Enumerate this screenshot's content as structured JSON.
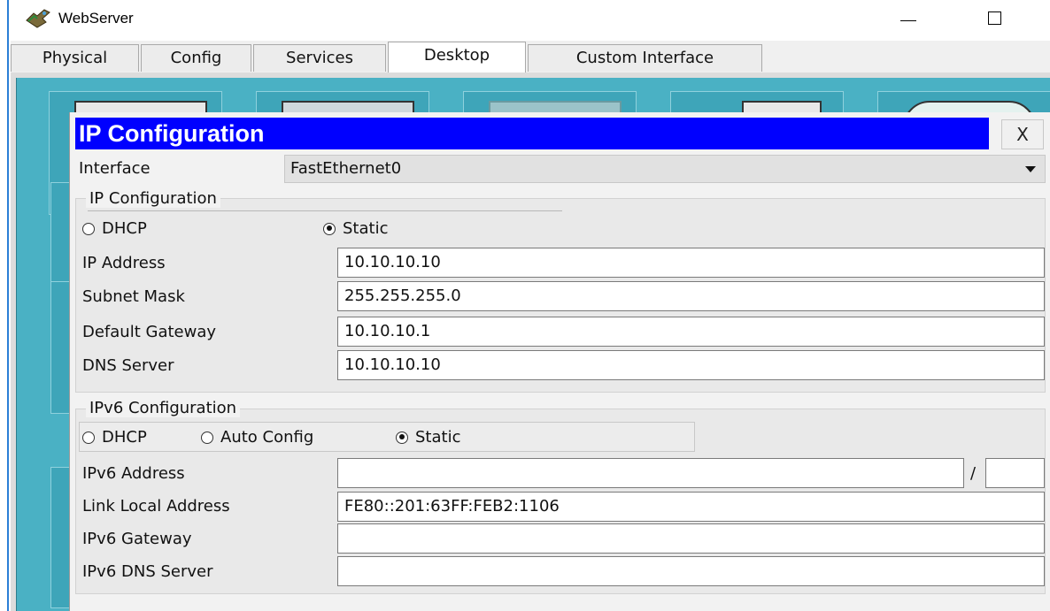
{
  "window": {
    "title": "WebServer",
    "icon": "packet-tracer-server-icon",
    "controls": {
      "minimize": "minimize-icon",
      "maximize": "maximize-icon"
    }
  },
  "tabs": [
    {
      "label": "Physical",
      "active": false
    },
    {
      "label": "Config",
      "active": false
    },
    {
      "label": "Services",
      "active": false
    },
    {
      "label": "Desktop",
      "active": true
    },
    {
      "label": "Custom Interface",
      "active": false
    }
  ],
  "dialog": {
    "title": "IP Configuration",
    "close_label": "X",
    "interface": {
      "label": "Interface",
      "value": "FastEthernet0"
    },
    "ipv4": {
      "legend": "IP Configuration",
      "dhcp_label": "DHCP",
      "static_label": "Static",
      "mode": "Static",
      "fields": {
        "ip_address": {
          "label": "IP Address",
          "value": "10.10.10.10"
        },
        "subnet_mask": {
          "label": "Subnet Mask",
          "value": "255.255.255.0"
        },
        "default_gateway": {
          "label": "Default Gateway",
          "value": "10.10.10.1"
        },
        "dns_server": {
          "label": "DNS Server",
          "value": "10.10.10.10"
        }
      }
    },
    "ipv6": {
      "legend": "IPv6 Configuration",
      "dhcp_label": "DHCP",
      "auto_label": "Auto Config",
      "static_label": "Static",
      "mode": "Static",
      "prefix_separator": "/",
      "fields": {
        "ipv6_address": {
          "label": "IPv6 Address",
          "value": "",
          "prefix": ""
        },
        "link_local": {
          "label": "Link Local Address",
          "value": "FE80::201:63FF:FEB2:1106"
        },
        "ipv6_gateway": {
          "label": "IPv6 Gateway",
          "value": ""
        },
        "ipv6_dns": {
          "label": "IPv6 DNS Server",
          "value": ""
        }
      }
    }
  },
  "colors": {
    "dialog_title_bg": "#0000ff",
    "desktop_bg": "#4ab1c4",
    "window_edge": "#2b7fd6"
  }
}
